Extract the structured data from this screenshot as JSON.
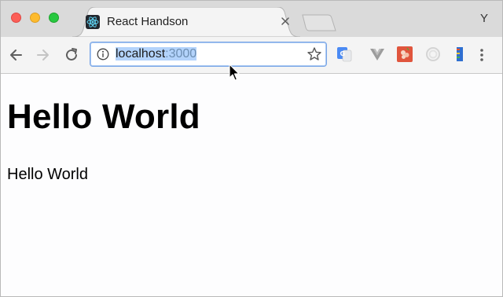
{
  "browser": {
    "tab": {
      "title": "React Handson",
      "favicon": "react-logo-icon"
    },
    "profile_initial": "Y",
    "omnibox": {
      "host": "localhost",
      "port": ":3000",
      "icon": "info-icon",
      "bookmark_icon": "star-icon"
    },
    "extensions": [
      "translate-icon",
      "vue-devtools-icon",
      "grape-extension-icon",
      "circle-extension-icon",
      "ruler-extension-icon"
    ],
    "colors": {
      "tabstrip": "#dadada",
      "toolbar": "#f4f4f4",
      "selection": "#b3d3fb",
      "react": "#61dafb"
    }
  },
  "page": {
    "heading": "Hello World",
    "paragraph": "Hello World"
  }
}
